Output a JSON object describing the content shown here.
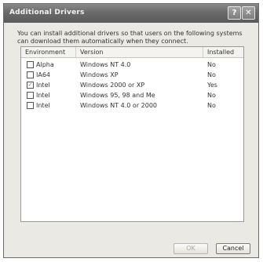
{
  "window": {
    "title": "Additional Drivers",
    "help_glyph": "?",
    "close_glyph": "✕"
  },
  "description": "You can install additional drivers so that users on the following systems can download them automatically when they connect.",
  "table": {
    "headers": [
      "Environment",
      "Version",
      "Installed"
    ],
    "rows": [
      {
        "environment": "Alpha",
        "version": "Windows NT 4.0",
        "installed": "No",
        "checked": false
      },
      {
        "environment": "IA64",
        "version": "Windows XP",
        "installed": "No",
        "checked": false
      },
      {
        "environment": "Intel",
        "version": "Windows 2000 or XP",
        "installed": "Yes",
        "checked": true
      },
      {
        "environment": "Intel",
        "version": "Windows 95, 98 and Me",
        "installed": "No",
        "checked": false
      },
      {
        "environment": "Intel",
        "version": "Windows NT 4.0 or 2000",
        "installed": "No",
        "checked": false
      }
    ]
  },
  "buttons": {
    "ok": "OK",
    "cancel": "Cancel"
  }
}
